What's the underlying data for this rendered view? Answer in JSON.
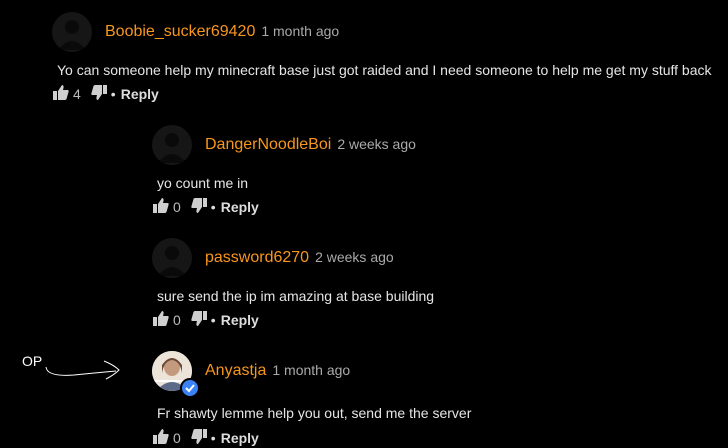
{
  "comments": [
    {
      "author": "Boobie_sucker69420",
      "time": "1 month ago",
      "text": "Yo can someone help my minecraft base just got raided and I need someone to help me get my stuff back",
      "likes": "4",
      "reply": "Reply",
      "dot": "•"
    },
    {
      "author": "DangerNoodleBoi",
      "time": "2 weeks ago",
      "text": "yo count me in",
      "likes": "0",
      "reply": "Reply",
      "dot": "•"
    },
    {
      "author": "password6270",
      "time": "2 weeks ago",
      "text": "sure send the ip im amazing at base building",
      "likes": "0",
      "reply": "Reply",
      "dot": "•"
    },
    {
      "author": "Anyastja",
      "time": "1 month ago",
      "text": "Fr shawty lemme help you out, send me the server",
      "likes": "0",
      "reply": "Reply",
      "dot": "•"
    }
  ],
  "annotation": {
    "label": "OP"
  },
  "icons": {
    "like": "thumbs-up-icon",
    "dislike": "thumbs-down-icon",
    "verified": "verified-check-icon"
  },
  "colors": {
    "author": "#f7971e",
    "background": "#000000",
    "verified": "#3b82f6"
  }
}
